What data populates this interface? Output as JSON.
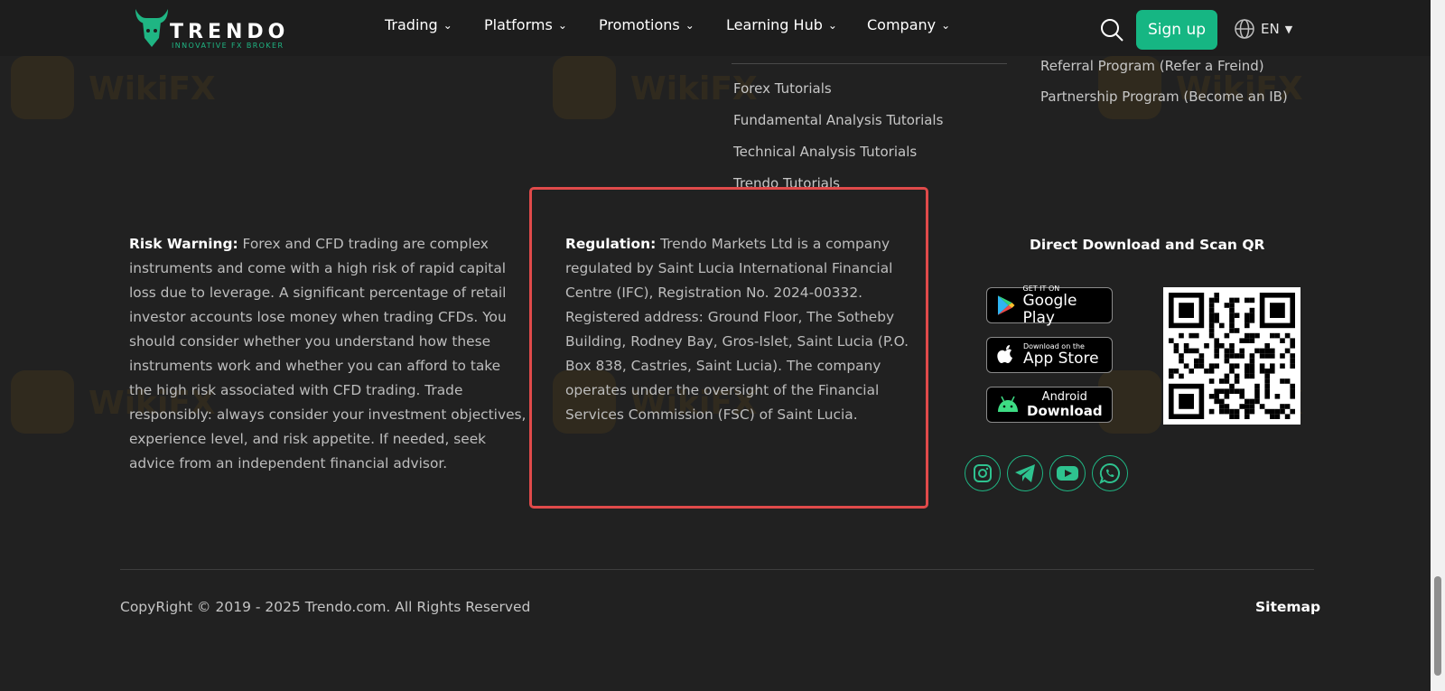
{
  "header": {
    "logo_text": "TRENDO",
    "logo_tagline": "INNOVATIVE FX BROKER",
    "nav": [
      "Trading",
      "Platforms",
      "Promotions",
      "Learning Hub",
      "Company"
    ],
    "signup_label": "Sign up",
    "language": "EN"
  },
  "learning_links": [
    "Forex Tutorials",
    "Fundamental Analysis Tutorials",
    "Technical Analysis Tutorials",
    "Trendo Tutorials"
  ],
  "program_links": [
    "Referral Program (Refer a Freind)",
    "Partnership Program (Become an IB)"
  ],
  "risk": {
    "label": "Risk Warning:",
    "text": " Forex and CFD trading are complex instruments and come with a high risk of rapid capital loss due to leverage. A significant percentage of retail investor accounts lose money when trading CFDs. You should consider whether you understand how these instruments work and whether you can afford to take the high risk associated with CFD trading. Trade responsibly: always consider your investment objectives, experience level, and risk appetite. If needed, seek advice from an independent financial advisor."
  },
  "regulation": {
    "label": "Regulation:",
    "text": " Trendo Markets Ltd is a company regulated by Saint Lucia International Financial Centre (IFC), Registration No. 2024-00332. Registered address: Ground Floor, The Sotheby Building, Rodney Bay, Gros-Islet, Saint Lucia (P.O. Box 838, Castries, Saint Lucia). The company operates under the oversight of the Financial Services Commission (FSC) of Saint Lucia."
  },
  "download": {
    "title": "Direct Download and Scan QR",
    "google_small": "GET IT ON",
    "google_big": "Google Play",
    "apple_small": "Download on the",
    "apple_big": "App Store",
    "android_small": "Android",
    "android_big": "Download"
  },
  "social_icons": [
    "instagram-icon",
    "telegram-icon",
    "youtube-icon",
    "whatsapp-icon"
  ],
  "footer": {
    "copyright": "CopyRight © 2019 - 2025 Trendo.com. All Rights Reserved",
    "sitemap": "Sitemap"
  },
  "colors": {
    "accent": "#16b683",
    "background": "#212121",
    "highlight_frame": "#e04a4a"
  }
}
